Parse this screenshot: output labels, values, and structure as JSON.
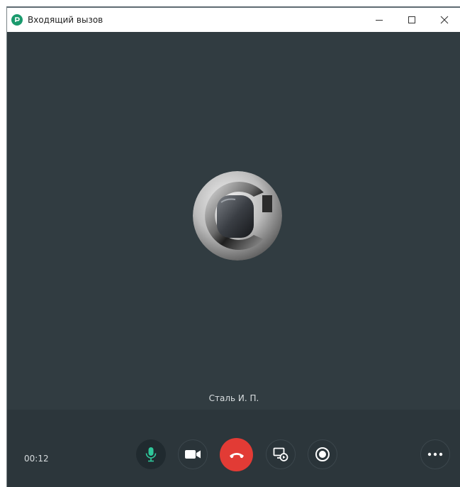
{
  "window": {
    "title": "Входящий вызов",
    "icons": {
      "app": "app-logo-icon",
      "minimize": "minimize-icon",
      "maximize": "maximize-icon",
      "close": "close-icon"
    }
  },
  "call": {
    "caller_name": "Сталь И. П.",
    "duration": "00:12",
    "avatar": "caller-avatar"
  },
  "controls": {
    "microphone": {
      "icon": "microphone-icon",
      "state": "on",
      "color": "#2fc79a"
    },
    "camera": {
      "icon": "video-camera-icon",
      "state": "off"
    },
    "hangup": {
      "icon": "phone-hangup-icon",
      "color": "#e23b35"
    },
    "screen_share": {
      "icon": "screen-share-icon"
    },
    "record": {
      "icon": "record-icon"
    },
    "more": {
      "icon": "more-dots-icon"
    }
  },
  "colors": {
    "background": "#313c41",
    "control_bar": "#2c363b",
    "accent": "#1a9a6d"
  }
}
